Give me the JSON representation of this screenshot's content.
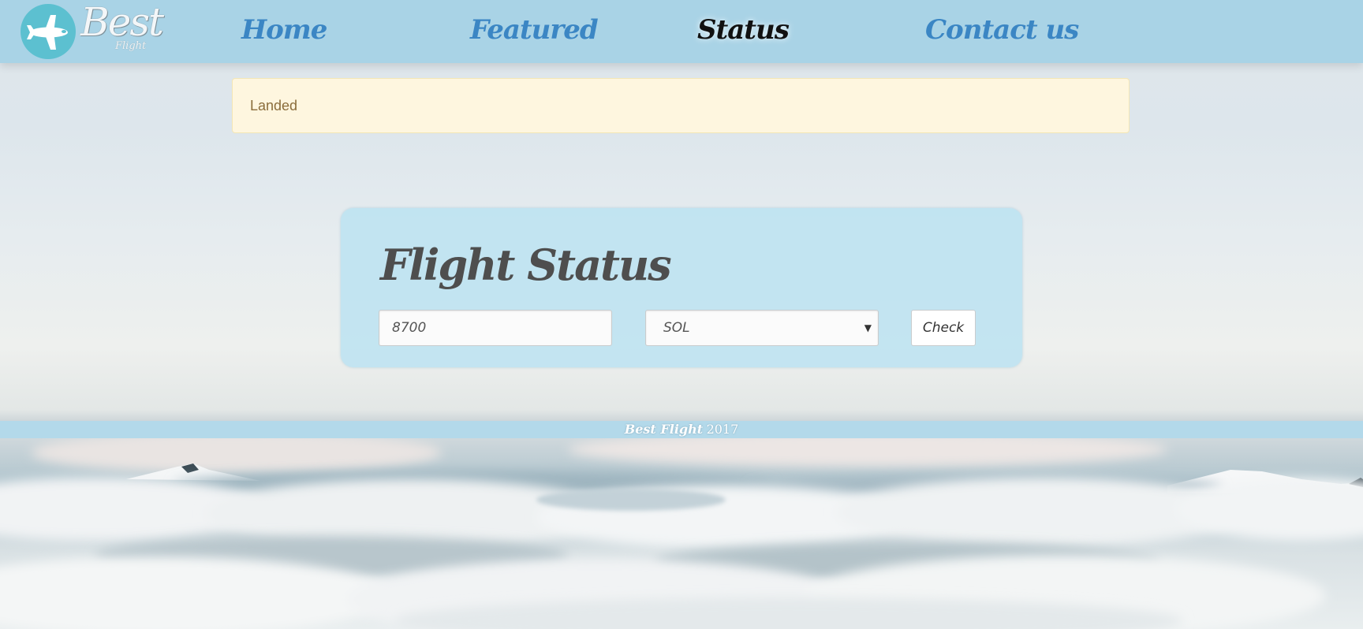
{
  "app": {
    "brand_name": "Best",
    "brand_subtitle": "Flight",
    "brand_icon": "airplane-icon"
  },
  "nav": {
    "items": [
      {
        "label": "Home",
        "active": false
      },
      {
        "label": "Featured",
        "active": false
      },
      {
        "label": "Status",
        "active": true
      },
      {
        "label": "Contact us",
        "active": false
      }
    ]
  },
  "alert": {
    "message": "Landed"
  },
  "status_form": {
    "title": "Flight Status",
    "flight_number_value": "8700",
    "destination_selected": "SOL",
    "caret_icon": "caret-down-icon",
    "check_label": "Check"
  },
  "footer": {
    "brand": "Best Flight",
    "year": "2017"
  },
  "colors": {
    "navbar_bg": "#a9d3e6",
    "nav_link": "#3b86c4",
    "nav_active": "#111111",
    "alert_bg": "#fef6df",
    "alert_text": "#8a6d3b",
    "panel_bg": "#bae2f1",
    "footer_bg": "#b3d9ea"
  }
}
